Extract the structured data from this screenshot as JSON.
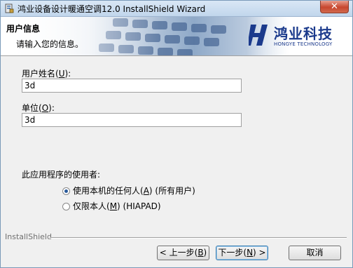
{
  "window": {
    "title": "鸿业设备设计暖通空调12.0 InstallShield Wizard",
    "close_glyph": "✕"
  },
  "banner": {
    "title": "用户信息",
    "subtitle": "请输入您的信息。",
    "logo_cn": "鸿业科技",
    "logo_en": "HONGYE TECHNOLOGY"
  },
  "form": {
    "username_label_pre": "用户姓名(",
    "username_label_key": "U",
    "username_label_post": "):",
    "username_value": "3d",
    "org_label_pre": "单位(",
    "org_label_key": "O",
    "org_label_post": "):",
    "org_value": "3d"
  },
  "usage": {
    "label": "此应用程序的使用者:",
    "option1_pre": "使用本机的任何人(",
    "option1_key": "A",
    "option1_post": ") (所有用户)",
    "option2_pre": "仅限本人(",
    "option2_key": "M",
    "option2_post": ") (HIAPAD)",
    "selected": "option1"
  },
  "footer": {
    "brand": "InstallShield",
    "back_pre": "< 上一步(",
    "back_key": "B",
    "back_post": ")",
    "next_pre": "下一步(",
    "next_key": "N",
    "next_post": ") >",
    "cancel": "取消"
  }
}
